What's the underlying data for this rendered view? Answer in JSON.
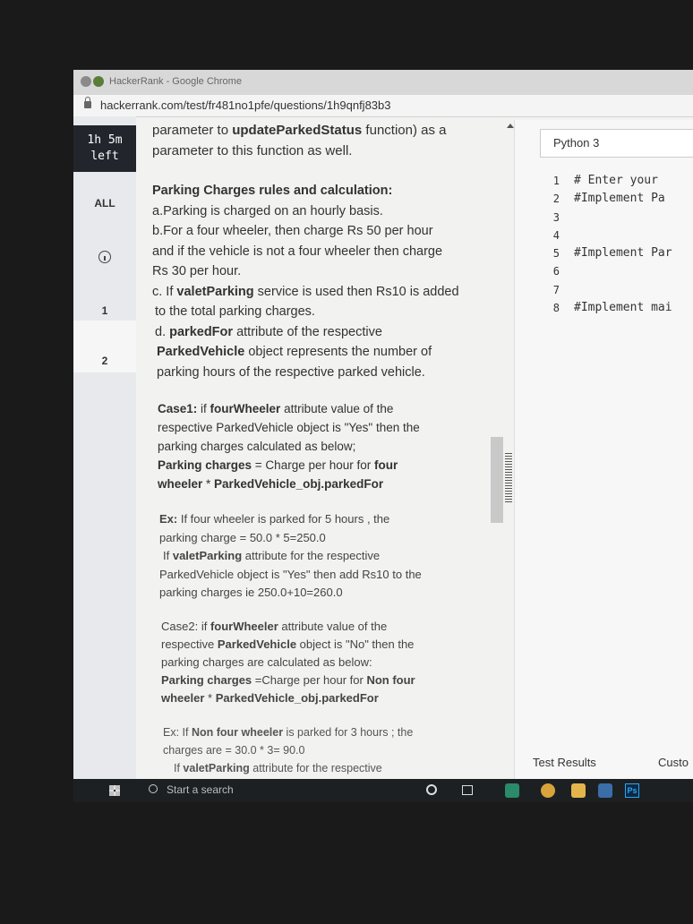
{
  "browser": {
    "title": "HackerRank - Google Chrome",
    "url": "hackerrank.com/test/fr481no1pfe/questions/1h9qnfj83b3"
  },
  "nav": {
    "timer_line1": "1h 5m",
    "timer_line2": "left",
    "all_label": "ALL",
    "question1": "1",
    "question2": "2"
  },
  "problem": {
    "intro_line1_pre": "parameter to ",
    "intro_line1_bold": "updateParkedStatus",
    "intro_line1_post": " function) as a",
    "intro_line2": "parameter to this function as well.",
    "rules_heading": "Parking Charges rules and calculation:",
    "rule_a": "a.Parking is charged on an hourly basis.",
    "rule_b_1": "b.For a four wheeler, then charge Rs 50 per hour",
    "rule_b_2": "and if the vehicle is not a four wheeler then charge",
    "rule_b_3": "Rs 30 per hour.",
    "rule_c_pre": "c. If ",
    "rule_c_bold": "valetParking",
    "rule_c_post": " service is used then Rs10 is added",
    "rule_c_2": "to the total parking charges.",
    "rule_d_pre": "d. ",
    "rule_d_bold": "parkedFor",
    "rule_d_post": " attribute of the respective",
    "rule_d_bold2": "ParkedVehicle",
    "rule_d_post2": " object represents the number of",
    "rule_d_3": "parking hours of the respective parked vehicle.",
    "case1_label": "Case1:",
    "case1_pre": " if ",
    "case1_bold": "fourWheeler",
    "case1_post": " attribute value of the",
    "case1_2": "respective ParkedVehicle object is \"Yes\" then the",
    "case1_3": "parking charges calculated as below;",
    "case1_4_bold": "Parking charges",
    "case1_4_mid": " = Charge per hour for ",
    "case1_4_bold2": "four",
    "case1_5_bold": "wheeler",
    "case1_5_mid": " * ",
    "case1_5_bold2": "ParkedVehicle_obj.parkedFor",
    "ex1_label": "Ex:",
    "ex1_1": " If four wheeler is parked for 5 hours ,  the",
    "ex1_2": "parking charge = 50.0 * 5=250.0",
    "ex1_3_pre": "If ",
    "ex1_3_bold": "valetParking",
    "ex1_3_post": " attribute for the respective",
    "ex1_4": "ParkedVehicle object is \"Yes\" then add Rs10 to the",
    "ex1_5": "parking charges ie 250.0+10=260.0",
    "case2_label": "Case2:",
    "case2_pre": " if ",
    "case2_bold": "fourWheeler",
    "case2_post": " attribute value of the",
    "case2_2_pre": "respective ",
    "case2_2_bold": "ParkedVehicle",
    "case2_2_post": " object is \"No\" then the",
    "case2_3": "parking charges are calculated as below:",
    "case2_4_bold": "Parking charges",
    "case2_4_mid": " =Charge per hour for ",
    "case2_4_bold2": "Non four",
    "case2_5_bold": "wheeler",
    "case2_5_mid": " * ",
    "case2_5_bold2": "ParkedVehicle_obj.parkedFor",
    "ex2_label": "Ex:",
    "ex2_pre": " If ",
    "ex2_bold": "Non four wheeler",
    "ex2_post": " is parked for 3 hours ;  the",
    "ex2_2": "charges are = 30.0 * 3= 90.0",
    "ex2_3_pre": "If ",
    "ex2_3_bold": "valetParking",
    "ex2_3_post": " attribute for the respective"
  },
  "editor": {
    "language": "Python 3",
    "line_numbers": [
      "1",
      "2",
      "3",
      "4",
      "5",
      "6",
      "7",
      "8"
    ],
    "lines": [
      "# Enter your",
      "#Implement Pa",
      "",
      "",
      "#Implement Par",
      "",
      "",
      "#Implement mai"
    ]
  },
  "bottom": {
    "test_results": "Test Results",
    "custom": "Custo"
  },
  "taskbar": {
    "search_placeholder": "Start a search",
    "ps_label": "Ps"
  }
}
